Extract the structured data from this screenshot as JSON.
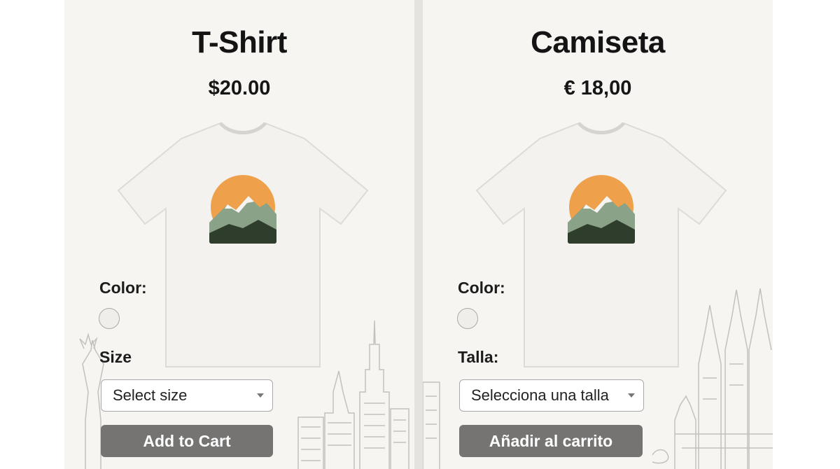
{
  "english": {
    "title": "T-Shirt",
    "price": "$20.00",
    "color_label": "Color:",
    "size_label": "Size",
    "size_select_value": "Select size",
    "add_to_cart_label": "Add to Cart",
    "swatch_color": "#efeeea"
  },
  "spanish": {
    "title": "Camiseta",
    "price": "€ 18,00",
    "color_label": "Color:",
    "size_label": "Talla:",
    "size_select_value": "Selecciona una talla",
    "add_to_cart_label": "Añadir al carrito",
    "swatch_color": "#efeeea"
  },
  "colors": {
    "shirt": "#f3f2ee",
    "sun": "#eea14a",
    "mountain_light": "#8aa287",
    "mountain_dark": "#2f3d2c",
    "button": "#757473"
  }
}
